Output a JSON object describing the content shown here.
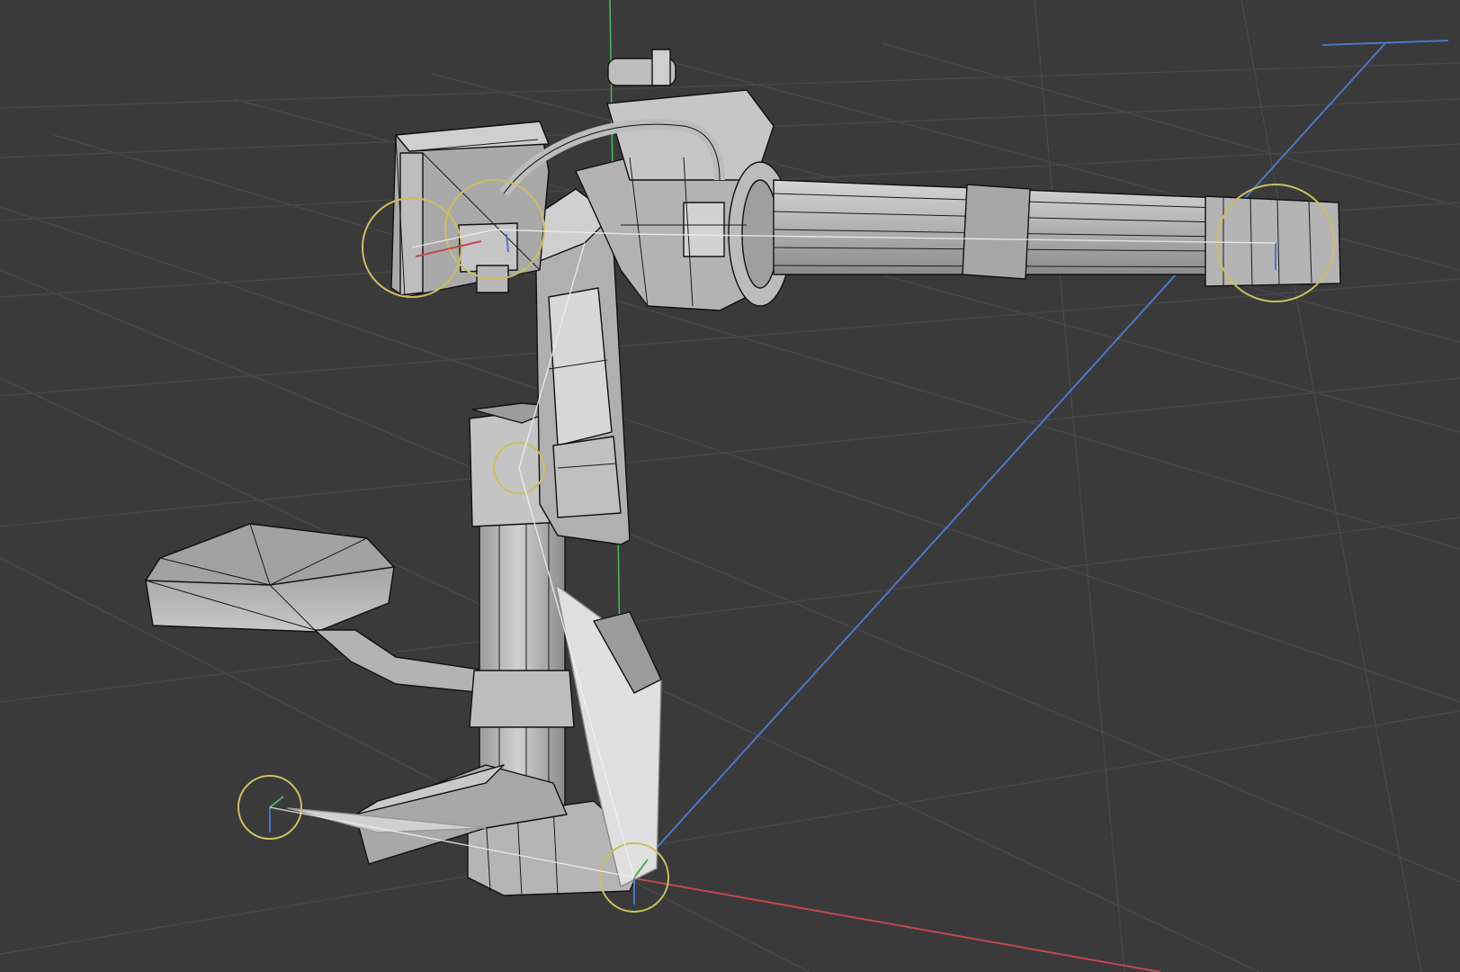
{
  "viewport": {
    "background": "#3a3a3a",
    "grid_color": "#4a4a4a",
    "grid_visible": true,
    "x_axis_color": "#c14b4b",
    "y_axis_color": "#46b45f",
    "z_axis_color": "#4a78c8",
    "model_color": "#b9b9b9",
    "model_shadow": "#8e8e8e",
    "wire_color": "#111111",
    "joint_color": "#c9c05f"
  },
  "model": {
    "name": "minigun-turret",
    "parts": [
      "seat-pad",
      "seat-arm",
      "base-pedestal",
      "column",
      "upper-arm",
      "rear-handle-frame",
      "motor-housing",
      "ammo-feed-hose",
      "barrel-cluster",
      "barrel-clamp",
      "muzzle-ring",
      "foot-struts"
    ]
  },
  "rig": {
    "joints": [
      "joint-rear-handle",
      "joint-rear-handle-inner",
      "joint-muzzle",
      "joint-column",
      "joint-base",
      "joint-foot"
    ]
  }
}
